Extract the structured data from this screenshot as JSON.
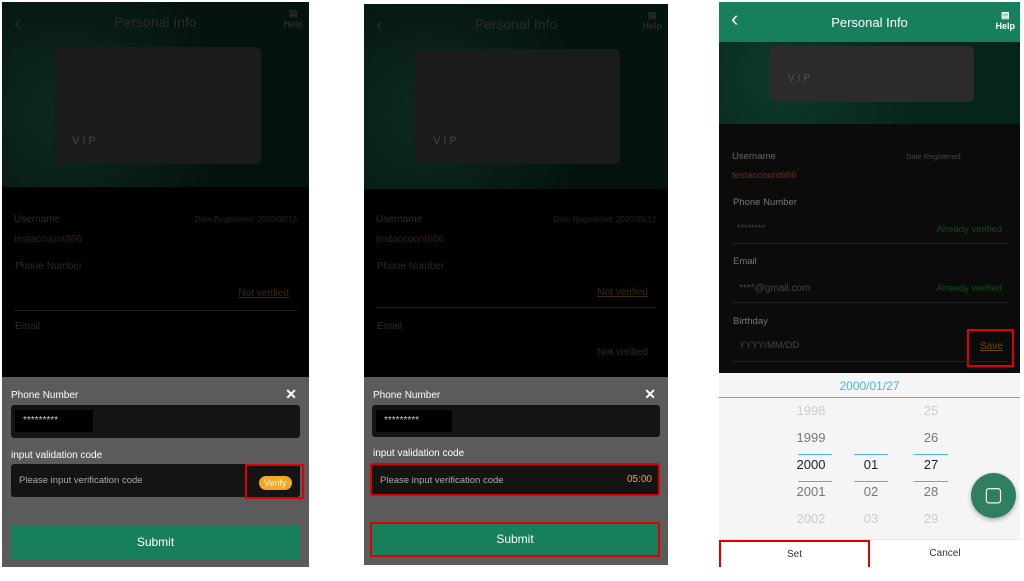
{
  "screens": [
    {
      "header": {
        "title": "Personal Info",
        "help": "Help"
      },
      "card_label": "VIP",
      "profile": {
        "username_label": "Username",
        "username": "testaccount666",
        "date_registered": "Date Registered: 2020/09/13",
        "phone_label": "Phone Number",
        "phone_status": "Not verified",
        "email_label": "Email"
      },
      "modal": {
        "phone_label": "Phone Number",
        "phone_value": "*********",
        "code_label": "input validation code",
        "code_placeholder": "Please input verification code",
        "verify": "Verify",
        "submit": "Submit"
      }
    },
    {
      "header": {
        "title": "Personal Info",
        "help": "Help"
      },
      "card_label": "VIP",
      "profile": {
        "username_label": "Username",
        "username": "testaccount666",
        "date_registered": "Date Registered: 2020/09/13",
        "phone_label": "Phone Number",
        "phone_status": "Not verified",
        "email_label": "Email",
        "email_status": "Not verified"
      },
      "modal": {
        "phone_label": "Phone Number",
        "phone_value": "*********",
        "code_label": "input validation code",
        "code_placeholder": "Please input verification code",
        "countdown": "05:00",
        "submit": "Submit"
      }
    },
    {
      "header": {
        "title": "Personal Info",
        "help": "Help"
      },
      "card_label": "VIP",
      "profile": {
        "username_label": "Username",
        "username": "testaccount666",
        "date_registered": "Date Registered:",
        "phone_label": "Phone Number",
        "phone_value": "********",
        "phone_status": "Already verified",
        "email_label": "Email",
        "email_value": "****@gmail.com",
        "email_status": "Already verified",
        "birthday_label": "Birthday",
        "birthday_placeholder": "YYYY/MM/DD",
        "save": "Save"
      },
      "picker": {
        "selected": "2000/01/27",
        "years": [
          "1998",
          "1999",
          "2000",
          "2001",
          "2002"
        ],
        "months": [
          "",
          "",
          "01",
          "02",
          "03"
        ],
        "days": [
          "25",
          "26",
          "27",
          "28",
          "29"
        ],
        "set": "Set",
        "cancel": "Cancel"
      }
    }
  ],
  "colors": {
    "brand_green": "#177f5c",
    "accent_orange": "#f5a623",
    "picker_blue": "#4ab3e8",
    "highlight_red": "#e00000"
  }
}
